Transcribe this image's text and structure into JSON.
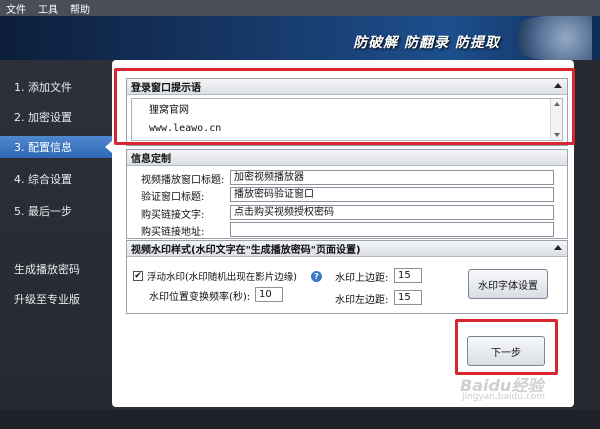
{
  "menu": [
    "文件",
    "工具",
    "帮助"
  ],
  "banner": {
    "slogan": "防破解 防翻录 防提取"
  },
  "sidebar": {
    "items": [
      {
        "label": "1. 添加文件",
        "active": false
      },
      {
        "label": "2. 加密设置",
        "active": false
      },
      {
        "label": "3. 配置信息",
        "active": true
      },
      {
        "label": "4. 综合设置",
        "active": false
      },
      {
        "label": "5. 最后一步",
        "active": false
      },
      {
        "label": "生成播放密码",
        "active": false
      },
      {
        "label": "升级至专业版",
        "active": false
      }
    ]
  },
  "login_hint": {
    "title": "登录窗口提示语",
    "lines": [
      "狸窝官网",
      "www.leawo.cn"
    ]
  },
  "info": {
    "title": "信息定制",
    "fields": [
      {
        "label": "视频播放窗口标题:",
        "value": "加密视频播放器"
      },
      {
        "label": "验证窗口标题:",
        "value": "播放密码验证窗口"
      },
      {
        "label": "购买链接文字:",
        "value": "点击购买视频授权密码"
      },
      {
        "label": "购买链接地址:",
        "value": ""
      }
    ]
  },
  "watermark_section": {
    "title": "视频水印样式(水印文字在\"生成播放密码\"页面设置)",
    "float_checkbox_label": "浮动水印(水印随机出现在影片边缘)",
    "float_checked": true,
    "checkbox_mark": "✔",
    "help_mark": "?",
    "freq_label": "水印位置变换频率(秒):",
    "freq_value": "10",
    "top_margin_label": "水印上边距:",
    "top_margin_value": "15",
    "left_margin_label": "水印左边距:",
    "left_margin_value": "15",
    "font_button": "水印字体设置"
  },
  "next_button": "下一步",
  "site_watermark": {
    "logo": "Baidu经验",
    "url": "jingyan.baidu.com"
  },
  "colors": {
    "highlight_frame": "#d8262e",
    "active_nav": "#3a76c1",
    "sidebar_bg": "#2b2e35"
  }
}
